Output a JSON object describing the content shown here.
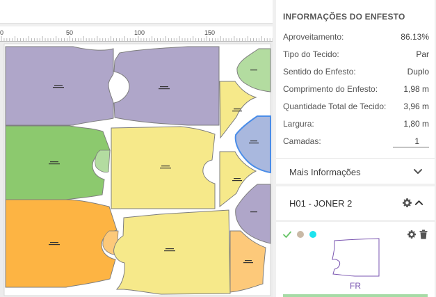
{
  "ruler": {
    "ticks": [
      "0",
      "50",
      "100",
      "150"
    ]
  },
  "colors": {
    "lavender": "#afa6c9",
    "green": "#8cc96e",
    "yellow": "#f6e98a",
    "orange": "#fdb443",
    "light_orange": "#fdc97a",
    "light_green": "#b3dca0",
    "blue_selected": "#a9b8de",
    "selected_stroke": "#4a8de8",
    "accent_purple": "#7a55b0"
  },
  "info": {
    "title": "INFORMAÇÕES DO ENFESTO",
    "rows": [
      {
        "label": "Aproveitamento:",
        "value": "86.13%"
      },
      {
        "label": "Tipo do Tecido:",
        "value": "Par"
      },
      {
        "label": "Sentido do Enfesto:",
        "value": "Duplo"
      },
      {
        "label": "Comprimento do Enfesto:",
        "value": "1,98 m"
      },
      {
        "label": "Quantidade Total de Tecido:",
        "value": "3,96 m"
      },
      {
        "label": "Largura:",
        "value": "1,80 m"
      }
    ],
    "layers": {
      "label": "Camadas:",
      "value": "1"
    },
    "more_label": "Mais Informações"
  },
  "group": {
    "name": "H01 - JONER 2",
    "item": {
      "dots": [
        "#c9b9a6",
        "#1de3ee"
      ],
      "label": "FR"
    }
  },
  "icons": {
    "more": "chevron-down-icon",
    "group_settings": "gear-icon",
    "group_toggle": "chevron-up-icon",
    "item_check": "check-icon",
    "item_settings": "gear-icon",
    "item_delete": "trash-icon"
  }
}
